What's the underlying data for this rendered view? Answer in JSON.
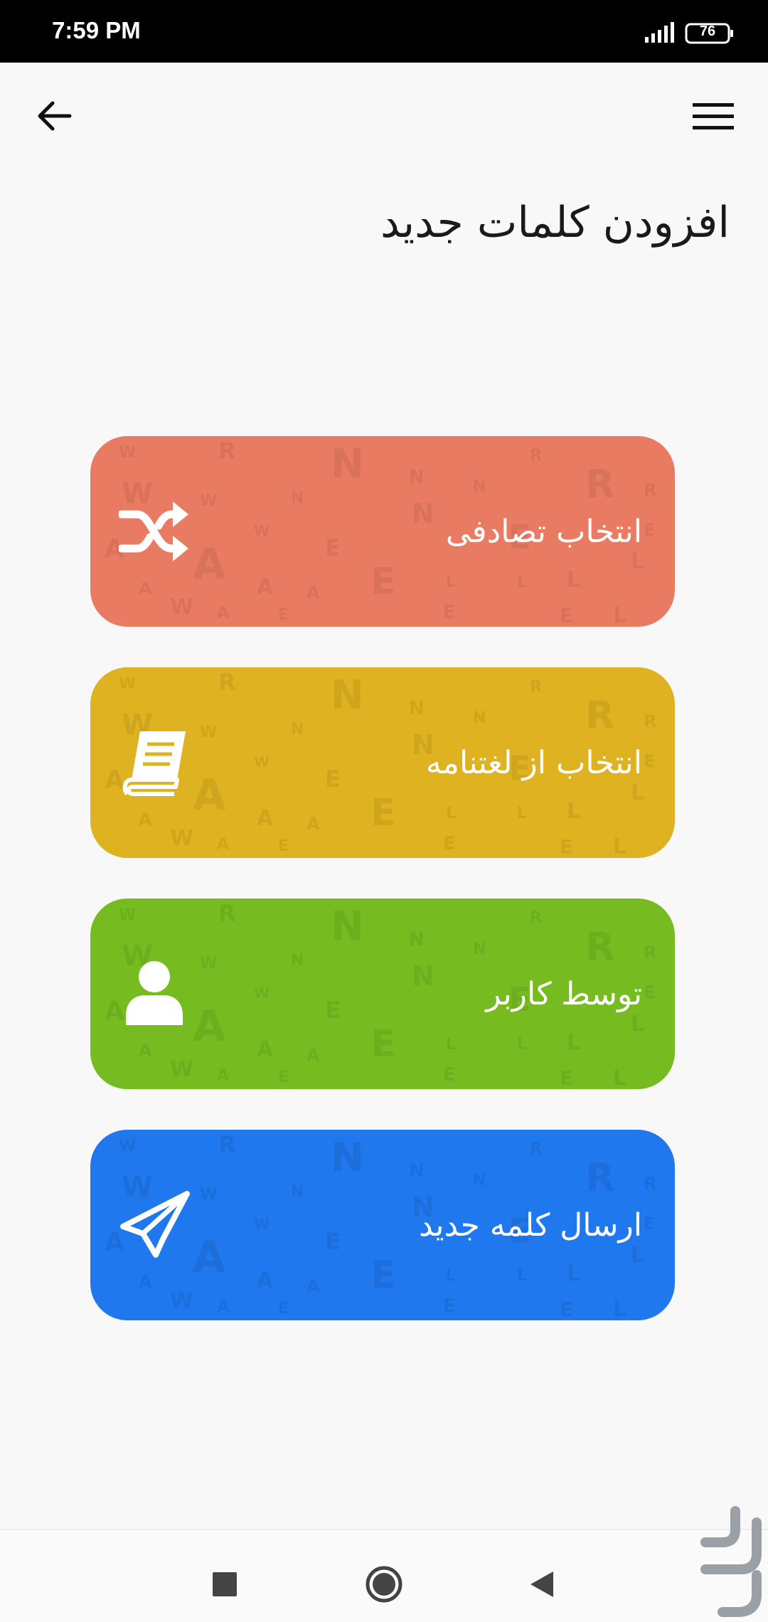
{
  "status_bar": {
    "time": "7:59 PM",
    "battery": "76"
  },
  "page": {
    "title": "افزودن کلمات جدید"
  },
  "options": [
    {
      "label": "انتخاب تصادفی",
      "icon": "shuffle-icon",
      "color": "#e97b62"
    },
    {
      "label": "انتخاب از لغتنامه",
      "icon": "book-icon",
      "color": "#dfb221"
    },
    {
      "label": "توسط کاربر",
      "icon": "user-icon",
      "color": "#76bc21"
    },
    {
      "label": "ارسال کلمه جدید",
      "icon": "paper-plane-icon",
      "color": "#2078ee"
    }
  ],
  "icons": {
    "back": "arrow-left-icon",
    "menu": "hamburger-menu-icon"
  },
  "colors": {
    "status_bar": "#000000",
    "background": "#f8f8f8"
  }
}
